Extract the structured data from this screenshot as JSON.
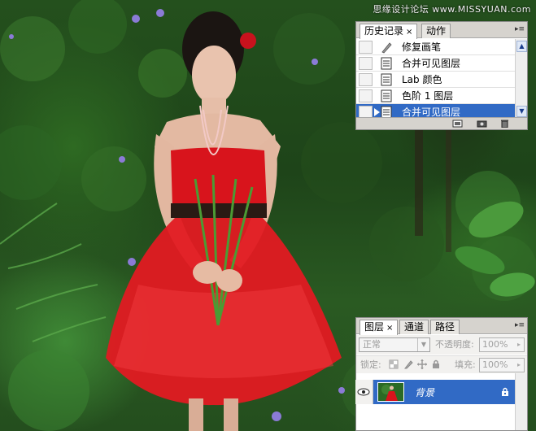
{
  "watermark": "思缘设计论坛 www.MISSYUAN.com",
  "history_panel": {
    "tabs": [
      {
        "label": "历史记录",
        "close": "×",
        "active": true
      },
      {
        "label": "动作",
        "active": false
      }
    ],
    "items": [
      {
        "label": "修复画笔",
        "icon": "healing-brush-icon",
        "selected": false
      },
      {
        "label": "合并可见图层",
        "icon": "document-icon",
        "selected": false
      },
      {
        "label": "Lab 颜色",
        "icon": "document-icon",
        "selected": false
      },
      {
        "label": "色阶 1 图层",
        "icon": "document-icon",
        "selected": false
      },
      {
        "label": "合并可见图层",
        "icon": "document-icon",
        "selected": true
      }
    ],
    "footer_icons": [
      "new-document-from-state-icon",
      "snapshot-camera-icon",
      "trash-icon"
    ]
  },
  "layers_panel": {
    "tabs": [
      {
        "label": "图层",
        "close": "×",
        "active": true
      },
      {
        "label": "通道",
        "active": false
      },
      {
        "label": "路径",
        "active": false
      }
    ],
    "blend_mode": "正常",
    "opacity_label": "不透明度:",
    "opacity_value": "100%",
    "lock_label": "锁定:",
    "fill_label": "填充:",
    "fill_value": "100%",
    "layers": [
      {
        "name": "背景",
        "visible": true,
        "locked": true,
        "selected": true
      }
    ]
  },
  "colors": {
    "selection": "#316ac5",
    "panel_chrome": "#d6d3ce",
    "dress_red": "#d8141c"
  }
}
